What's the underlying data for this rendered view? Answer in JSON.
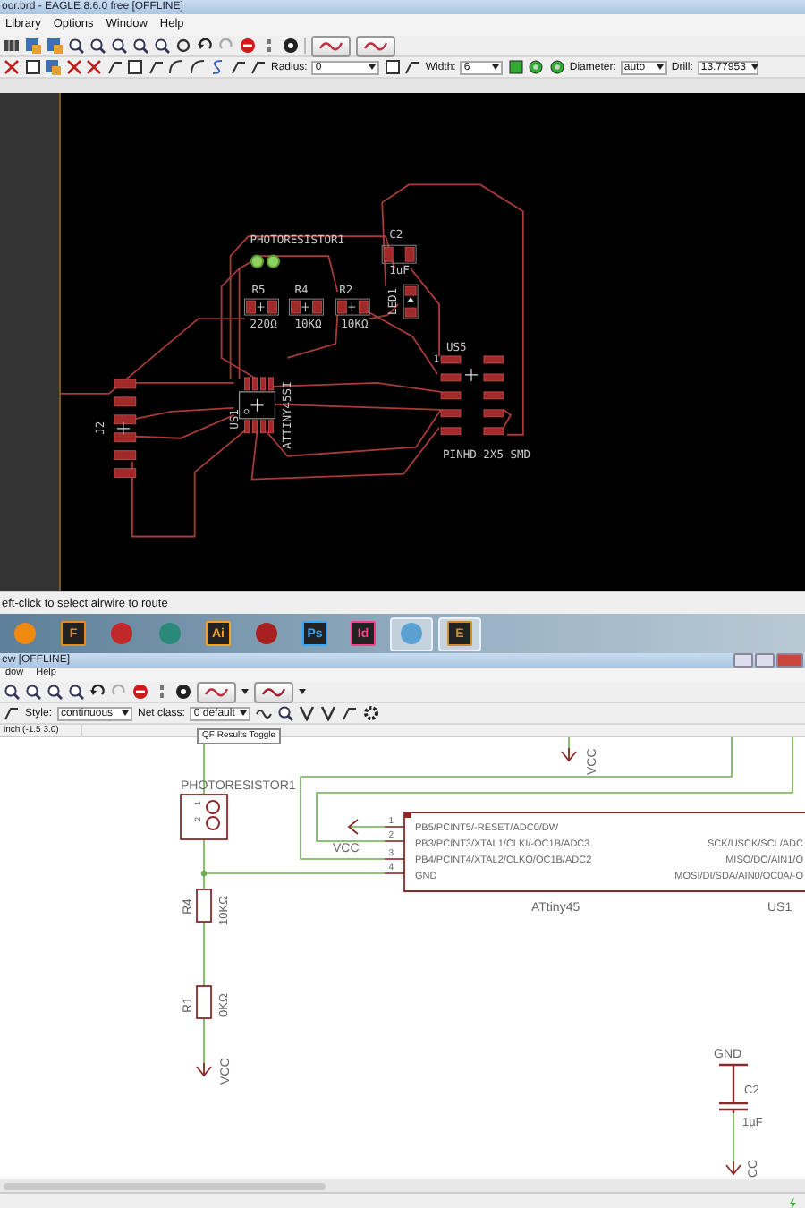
{
  "board_window": {
    "title": "oor.brd - EAGLE 8.6.0 free [OFFLINE]",
    "menu": [
      "Library",
      "Options",
      "Window",
      "Help"
    ],
    "fields": [
      {
        "label": "Radius:",
        "value": "0"
      },
      {
        "label": "Width:",
        "value": "6"
      },
      {
        "label": "Diameter:",
        "value": "auto"
      },
      {
        "label": "Drill:",
        "value": "13.77953"
      }
    ],
    "labels": [
      {
        "text": "PHOTORESISTOR1"
      },
      {
        "text": "C2"
      },
      {
        "text": "1uF"
      },
      {
        "text": "R5"
      },
      {
        "text": "R4"
      },
      {
        "text": "R2"
      },
      {
        "text": "220Ω"
      },
      {
        "text": "10KΩ"
      },
      {
        "text": "10KΩ"
      },
      {
        "text": "LED1"
      },
      {
        "text": "US5"
      },
      {
        "text": "1"
      },
      {
        "text": "PINHD-2X5-SMD"
      },
      {
        "text": "ATTINY45SI"
      },
      {
        "text": "US1"
      },
      {
        "text": "J2"
      }
    ],
    "status": "eft-click to select airwire to route"
  },
  "taskbar": {
    "apps": [
      {
        "color": "#f08a10",
        "active": false
      },
      {
        "label": "F",
        "color": "#e8891e",
        "active": false
      },
      {
        "color": "#c0282a",
        "active": false
      },
      {
        "color": "#2a8a7a",
        "active": false
      },
      {
        "label": "Ai",
        "color": "#f7a01c",
        "active": false
      },
      {
        "color": "#a82020",
        "active": false
      },
      {
        "label": "Ps",
        "color": "#31a8ff",
        "active": false
      },
      {
        "label": "Id",
        "color": "#ff3d8b",
        "active": false
      },
      {
        "color": "#5aa0d0",
        "active": true
      },
      {
        "label": "E",
        "color": "#d08a30",
        "active": true
      }
    ]
  },
  "schematic_window": {
    "title": "ew [OFFLINE]",
    "menu": [
      "dow",
      "Help"
    ],
    "fields": [
      {
        "label": "Style:",
        "value": "continuous"
      },
      {
        "label": "Net class:",
        "value": "0 default"
      }
    ],
    "tooltip": "QF Results Toggle",
    "coordinates": "inch (-1.5 3.0)",
    "labels": [
      {
        "text": "VCC"
      },
      {
        "text": "PHOTORESISTOR1"
      },
      {
        "text": "1"
      },
      {
        "text": "2"
      },
      {
        "text": "1"
      },
      {
        "text": "2"
      },
      {
        "text": "3"
      },
      {
        "text": "4"
      },
      {
        "text": "PB5/PCINT5/-RESET/ADC0/DW"
      },
      {
        "text": "PB3/PCINT3/XTAL1/CLKI/-OC1B/ADC3"
      },
      {
        "text": "PB4/PCINT4/XTAL2/CLKO/OC1B/ADC2"
      },
      {
        "text": "GND"
      },
      {
        "text": "SCK/USCK/SCL/ADC"
      },
      {
        "text": "MISO/DO/AIN1/O"
      },
      {
        "text": "MOSI/DI/SDA/AIN0/OC0A/-O"
      },
      {
        "text": "VCC"
      },
      {
        "text": "ATtiny45"
      },
      {
        "text": "US1"
      },
      {
        "text": "R4"
      },
      {
        "text": "10KΩ"
      },
      {
        "text": "R1"
      },
      {
        "text": "0KΩ"
      },
      {
        "text": "VCC"
      },
      {
        "text": "GND"
      },
      {
        "text": "C2"
      },
      {
        "text": "1µF"
      },
      {
        "text": "CC"
      }
    ]
  }
}
